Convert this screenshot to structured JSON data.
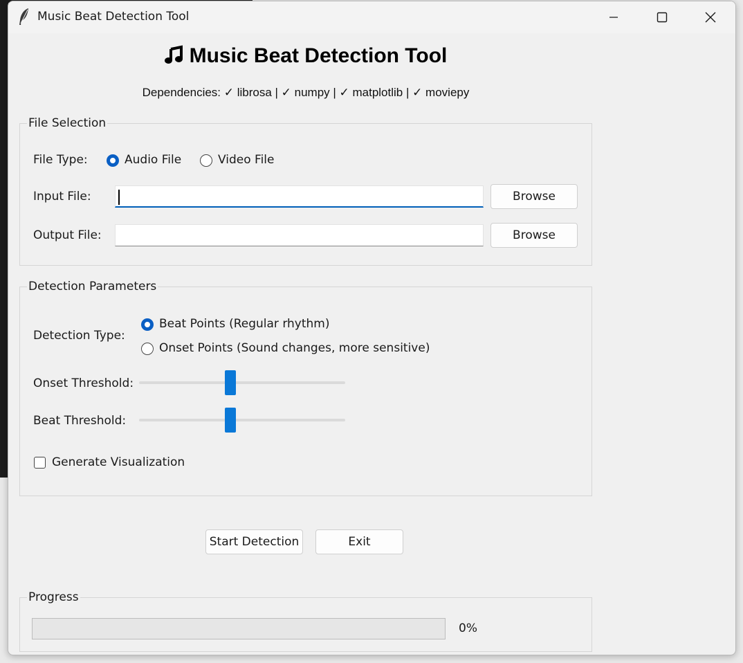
{
  "window": {
    "title": "Music Beat Detection Tool"
  },
  "header": {
    "title": "Music Beat Detection Tool",
    "dependencies": "Dependencies: ✓ librosa | ✓ numpy | ✓ matplotlib | ✓ moviepy"
  },
  "file_selection": {
    "group_label": "File Selection",
    "file_type_label": "File Type:",
    "file_type_options": [
      {
        "label": "Audio File",
        "selected": true
      },
      {
        "label": "Video File",
        "selected": false
      }
    ],
    "input_label": "Input File:",
    "input_value": "",
    "output_label": "Output File:",
    "output_value": "",
    "browse_label": "Browse"
  },
  "detection": {
    "group_label": "Detection Parameters",
    "type_label": "Detection Type:",
    "type_options": [
      {
        "label": "Beat Points (Regular rhythm)",
        "selected": true
      },
      {
        "label": "Onset Points (Sound changes, more sensitive)",
        "selected": false
      }
    ],
    "onset_label": "Onset Threshold:",
    "onset_value_fraction": 0.44,
    "beat_label": "Beat Threshold:",
    "beat_value_fraction": 0.44,
    "visualization_label": "Generate Visualization",
    "visualization_checked": false
  },
  "actions": {
    "start_label": "Start Detection",
    "exit_label": "Exit"
  },
  "progress": {
    "group_label": "Progress",
    "value_fraction": 0,
    "text": "0%"
  },
  "colors": {
    "accent": "#0a78d7",
    "radio_selected": "#0a5fc4",
    "window_bg": "#f0f0f0"
  },
  "icons": {
    "app": "feather-icon",
    "title": "music-note-icon"
  }
}
